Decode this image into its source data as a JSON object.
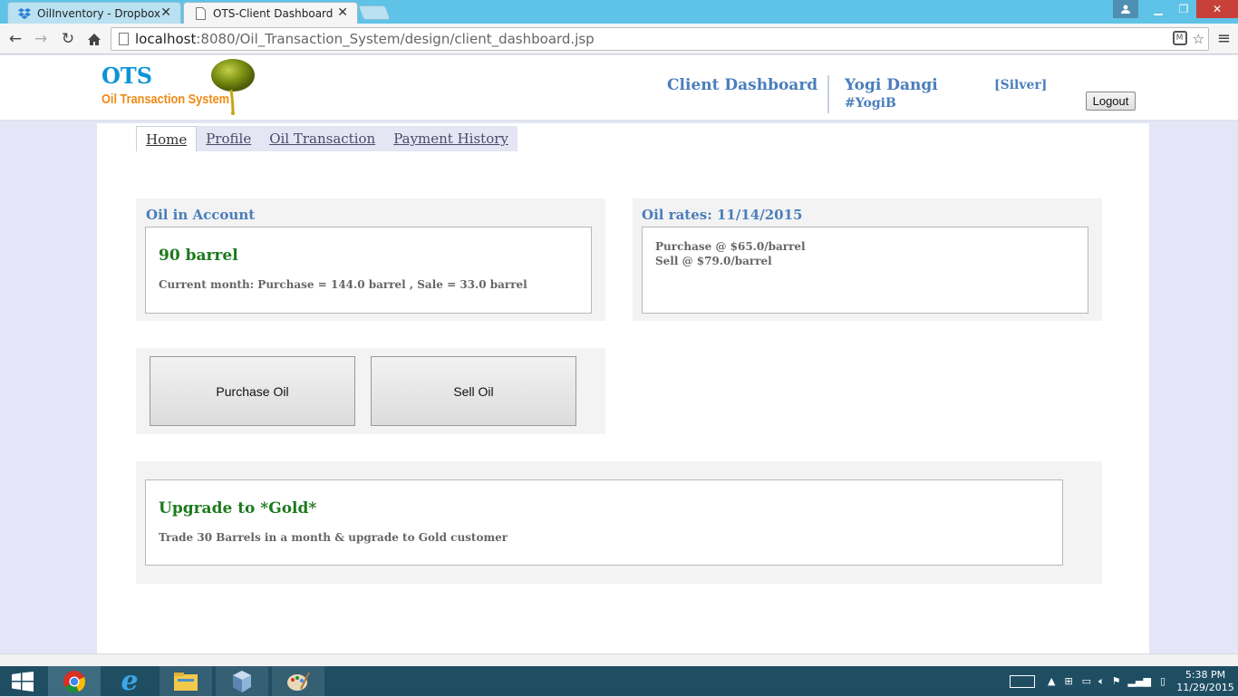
{
  "browser": {
    "tabs": [
      {
        "label": "OilInventory - Dropbox",
        "icon": "dropbox-icon"
      },
      {
        "label": "OTS-Client Dashboard",
        "icon": "page-icon"
      }
    ],
    "url_host": "localhost",
    "url_path": ":8080/Oil_Transaction_System/design/client_dashboard.jsp"
  },
  "header": {
    "logo_title": "OTS",
    "logo_subtitle": "Oil Transaction System",
    "title": "Client Dashboard",
    "user_name": "Yogi Dangi",
    "user_handle": "#YogiB",
    "user_level": "[Silver]",
    "logout_label": "Logout"
  },
  "nav": {
    "items": [
      "Home",
      "Profile",
      "Oil Transaction",
      "Payment History"
    ],
    "active": "Home"
  },
  "oil_account": {
    "title": "Oil in Account",
    "amount": "90 barrel",
    "summary": "Current month: Purchase = 144.0 barrel , Sale = 33.0 barrel"
  },
  "oil_rates": {
    "title": "Oil rates: 11/14/2015",
    "purchase": "Purchase @ $65.0/barrel",
    "sell": "Sell @ $79.0/barrel"
  },
  "actions": {
    "purchase_label": "Purchase Oil",
    "sell_label": "Sell Oil"
  },
  "upgrade": {
    "title": "Upgrade to *Gold*",
    "text": "Trade 30 Barrels in a month & upgrade to Gold customer"
  },
  "taskbar": {
    "time": "5:38 PM",
    "date": "11/29/2015"
  },
  "colors": {
    "accent_blue": "#4a7ebb",
    "green": "#1d7a1d",
    "logo_blue": "#0e94d6",
    "logo_orange": "#f08a14"
  }
}
